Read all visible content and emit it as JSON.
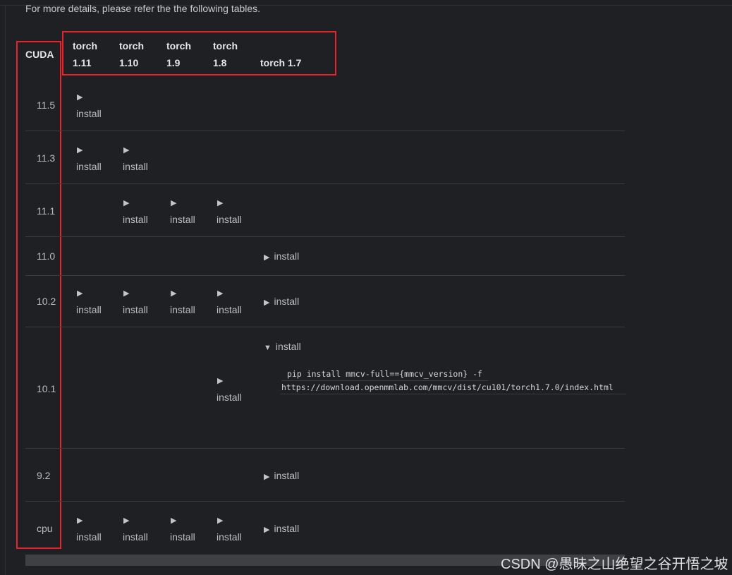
{
  "intro_text": "For more details, please refer the the following tables.",
  "header": {
    "cuda": "CUDA",
    "torch_cols": [
      {
        "line1": "torch",
        "line2": "1.11"
      },
      {
        "line1": "torch",
        "line2": "1.10"
      },
      {
        "line1": "torch",
        "line2": "1.9"
      },
      {
        "line1": "torch",
        "line2": "1.8"
      },
      {
        "line1": "",
        "line2": "torch 1.7"
      }
    ]
  },
  "rows": [
    {
      "cuda": "11.5"
    },
    {
      "cuda": "11.3"
    },
    {
      "cuda": "11.1"
    },
    {
      "cuda": "11.0"
    },
    {
      "cuda": "10.2"
    },
    {
      "cuda": "10.1"
    },
    {
      "cuda": "9.2"
    },
    {
      "cuda": "cpu"
    }
  ],
  "install_label": "install",
  "icons": {
    "collapsed": "triangle-right-icon",
    "expanded": "triangle-down-icon"
  },
  "expanded_code": {
    "line1": "pip install mmcv-full=={mmcv_version} -f",
    "line2": "https://download.openmmlab.com/mmcv/dist/cu101/torch1.7.0/index.html"
  },
  "watermark": "CSDN @愚昧之山绝望之谷开悟之坡",
  "colors": {
    "highlight_box": "#e8232b",
    "background": "#1f2023"
  }
}
